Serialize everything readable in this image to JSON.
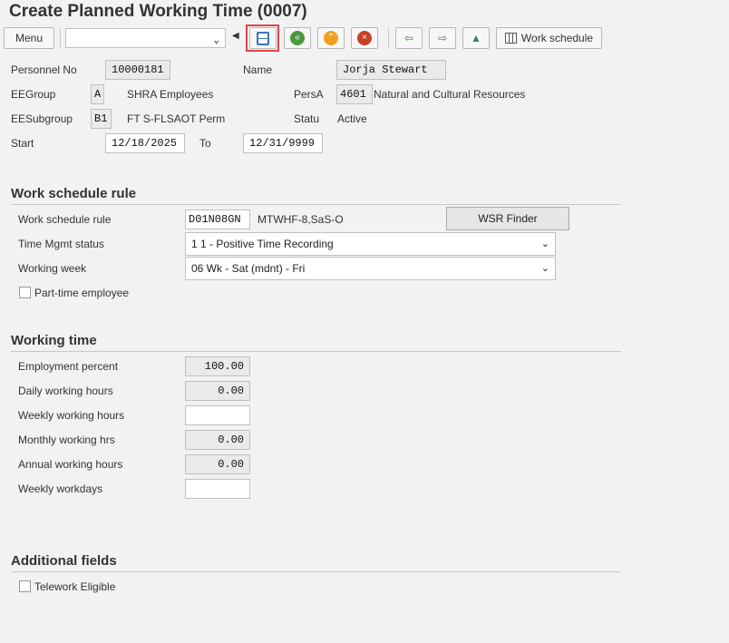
{
  "title": "Create Planned Working Time (0007)",
  "toolbar": {
    "menu": "Menu",
    "work_schedule": "Work schedule",
    "command_value": ""
  },
  "header": {
    "personnel_no_label": "Personnel No",
    "personnel_no": "10000181",
    "name_label": "Name",
    "name": "Jorja Stewart",
    "eegroup_label": "EEGroup",
    "eegroup": "A",
    "eegroup_text": "SHRA Employees",
    "persa_label": "PersA",
    "persa": "4601",
    "persa_text": "Natural and Cultural Resources",
    "eesubgroup_label": "EESubgroup",
    "eesubgroup": "B1",
    "eesubgroup_text": "FT S-FLSAOT Perm",
    "status_label": "Statu",
    "status": "Active",
    "start_label": "Start",
    "start": "12/18/2025",
    "to_label": "To",
    "to": "12/31/9999"
  },
  "wsr": {
    "section": "Work schedule rule",
    "rule_label": "Work schedule rule",
    "rule": "D01N08GN",
    "rule_text": "MTWHF-8,SaS-O",
    "finder": "WSR Finder",
    "tm_status_label": "Time Mgmt status",
    "tm_status": "1 1 - Positive Time Recording",
    "working_week_label": "Working week",
    "working_week": "06 Wk - Sat (mdnt) - Fri",
    "part_time_label": "Part-time employee"
  },
  "working_time": {
    "section": "Working time",
    "rows": [
      {
        "label": "Employment percent",
        "value": "100.00"
      },
      {
        "label": "Daily working hours",
        "value": "0.00"
      },
      {
        "label": "Weekly working hours",
        "value": ""
      },
      {
        "label": "Monthly working hrs",
        "value": "0.00"
      },
      {
        "label": "Annual working hours",
        "value": "0.00"
      },
      {
        "label": "Weekly workdays",
        "value": ""
      }
    ]
  },
  "additional": {
    "section": "Additional fields",
    "telework_label": "Telework Eligible"
  }
}
